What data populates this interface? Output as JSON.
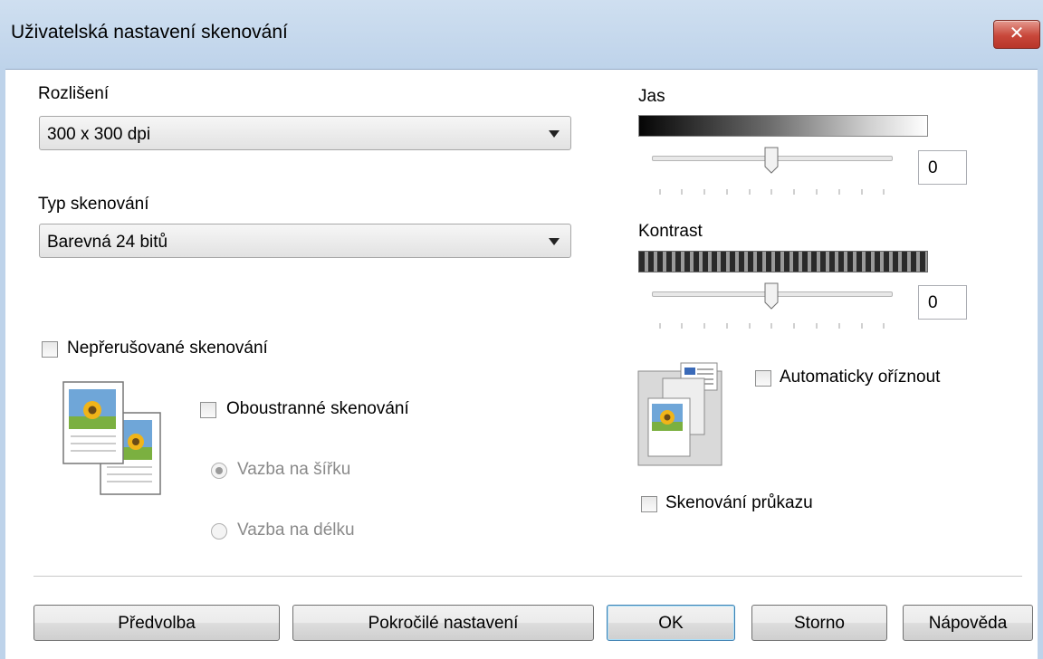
{
  "window": {
    "title": "Uživatelská nastavení skenování",
    "close_glyph": "✕"
  },
  "resolution": {
    "label": "Rozlišení",
    "value": "300 x 300 dpi"
  },
  "scan_type": {
    "label": "Typ skenování",
    "value": "Barevná 24 bitů"
  },
  "continuous_scan": {
    "label": "Nepřerušované skenování",
    "checked": false
  },
  "duplex_scan": {
    "label": "Oboustranné skenování",
    "checked": false
  },
  "binding_long": {
    "label": "Vazba na šířku",
    "selected": true,
    "disabled": true
  },
  "binding_short": {
    "label": "Vazba na délku",
    "selected": false,
    "disabled": true
  },
  "brightness": {
    "label": "Jas",
    "value": "0"
  },
  "contrast": {
    "label": "Kontrast",
    "value": "0"
  },
  "auto_crop": {
    "label": "Automaticky oříznout",
    "checked": false
  },
  "id_card_scan": {
    "label": "Skenování průkazu",
    "checked": false
  },
  "buttons": {
    "preset": "Předvolba",
    "advanced": "Pokročilé nastavení",
    "ok": "OK",
    "cancel": "Storno",
    "help": "Nápověda"
  },
  "icons": {
    "close": "close-icon",
    "duplex": "duplex-pages-icon",
    "autocrop": "auto-crop-icon"
  },
  "colors": {
    "titlebar": "#bed3ea",
    "close": "#c8473a",
    "default_button_border": "#3c7fb1"
  }
}
